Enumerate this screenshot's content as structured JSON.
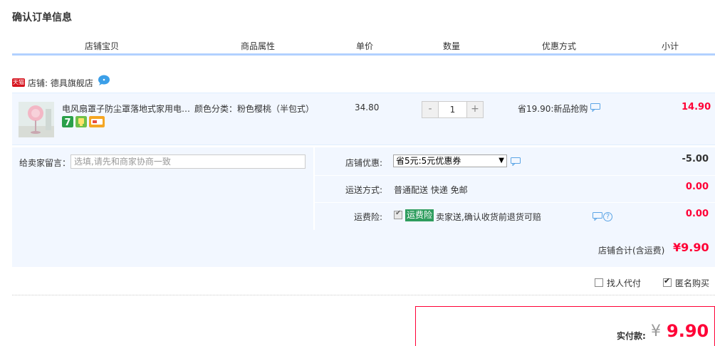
{
  "page_title": "确认订单信息",
  "table_headers": [
    "店铺宝贝",
    "商品属性",
    "单价",
    "数量",
    "优惠方式",
    "小计"
  ],
  "shop": {
    "badge": "天猫",
    "label": "店铺: 德具旗舰店"
  },
  "item": {
    "title": "电风扇罩子防尘罩落地式家用电风扇套全包",
    "attr": "颜色分类：粉色樱桃（半包式）",
    "price": "34.80",
    "qty_minus": "-",
    "qty": "1",
    "qty_plus": "+",
    "promo": "省19.90:新品抢购",
    "subtotal": "14.90"
  },
  "message": {
    "label": "给卖家留言：",
    "placeholder": "选填,请先和商家协商一致"
  },
  "shop_discount": {
    "label": "店铺优惠:",
    "selected": "省5元:5元优惠券",
    "arrow": "▼",
    "amount": "-5.00"
  },
  "shipping": {
    "label": "运送方式:",
    "value": "普通配送 快递 免邮",
    "amount": "0.00"
  },
  "insurance": {
    "label": "运费险:",
    "tag": "运费险",
    "text": "卖家送,确认收货前退货可赔",
    "help": "?",
    "amount": "0.00"
  },
  "shop_total": {
    "label": "店铺合计(含运费)",
    "amount": "¥9.90"
  },
  "bottom": {
    "proxy_pay": "找人代付",
    "anonymous": "匿名购买"
  },
  "pay": {
    "label": "实付款:",
    "yen": "¥",
    "amount": "9.90"
  },
  "colors": {
    "accent_red": "#ff0036",
    "row_bg": "#f2f7ff",
    "header_border": "#b2d1ff",
    "insurance_green": "#2e9d5e"
  }
}
